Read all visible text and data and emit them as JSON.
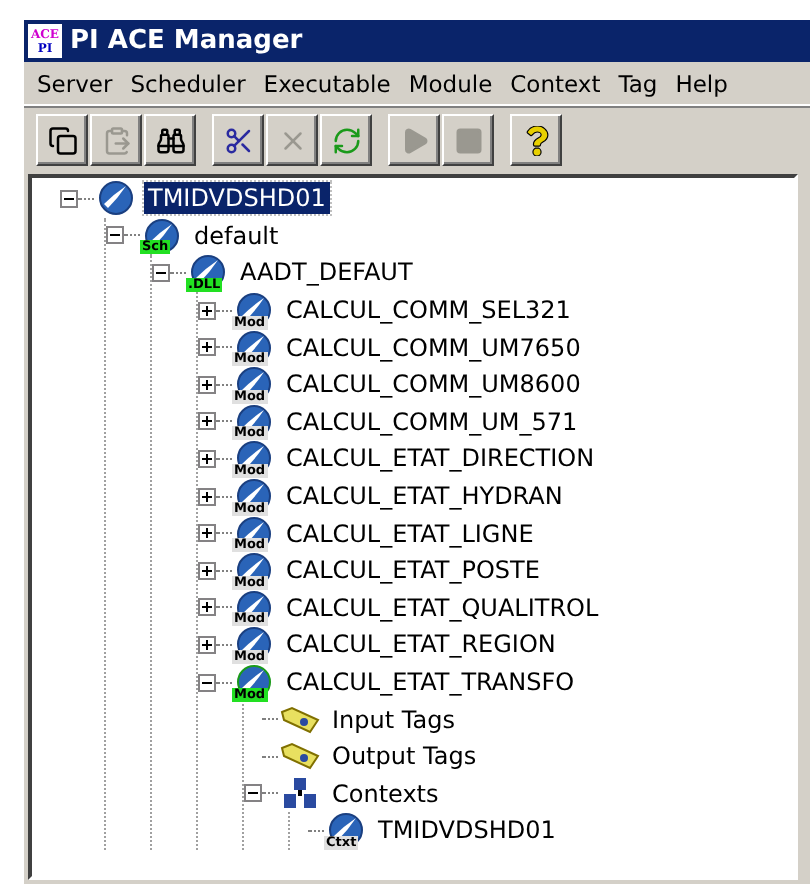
{
  "window": {
    "title": "PI ACE Manager",
    "app_icon": [
      "ACE",
      "PI"
    ]
  },
  "menu": [
    "Server",
    "Scheduler",
    "Executable",
    "Module",
    "Context",
    "Tag",
    "Help"
  ],
  "toolbar": [
    [
      {
        "kind": "copy",
        "disabled": false
      },
      {
        "kind": "paste",
        "disabled": true
      },
      {
        "kind": "find",
        "disabled": false
      }
    ],
    [
      {
        "kind": "cut",
        "disabled": false
      },
      {
        "kind": "delete",
        "disabled": true
      },
      {
        "kind": "refresh",
        "disabled": false
      }
    ],
    [
      {
        "kind": "play",
        "disabled": true
      },
      {
        "kind": "stop",
        "disabled": true
      }
    ],
    [
      {
        "kind": "help",
        "disabled": false
      }
    ]
  ],
  "tree": [
    {
      "label": "TMIDVDSHD01",
      "kind": "server",
      "selected": true,
      "expanded": true,
      "children": [
        {
          "label": "default",
          "kind": "scheduler",
          "badge": "Sch",
          "selected": false,
          "expanded": true,
          "children": [
            {
              "label": "AADT_DEFAUT",
              "kind": "dll",
              "badge": ".DLL",
              "selected": false,
              "expanded": true,
              "children": [
                {
                  "label": "CALCUL_COMM_SEL321",
                  "kind": "module",
                  "badge": "Mod",
                  "selected": false,
                  "expanded": false
                },
                {
                  "label": "CALCUL_COMM_UM7650",
                  "kind": "module",
                  "badge": "Mod",
                  "selected": false,
                  "expanded": false
                },
                {
                  "label": "CALCUL_COMM_UM8600",
                  "kind": "module",
                  "badge": "Mod",
                  "selected": false,
                  "expanded": false
                },
                {
                  "label": "CALCUL_COMM_UM_571",
                  "kind": "module",
                  "badge": "Mod",
                  "selected": false,
                  "expanded": false
                },
                {
                  "label": "CALCUL_ETAT_DIRECTION",
                  "kind": "module",
                  "badge": "Mod",
                  "selected": false,
                  "expanded": false
                },
                {
                  "label": "CALCUL_ETAT_HYDRAN",
                  "kind": "module",
                  "badge": "Mod",
                  "selected": false,
                  "expanded": false
                },
                {
                  "label": "CALCUL_ETAT_LIGNE",
                  "kind": "module",
                  "badge": "Mod",
                  "selected": false,
                  "expanded": false
                },
                {
                  "label": "CALCUL_ETAT_POSTE",
                  "kind": "module",
                  "badge": "Mod",
                  "selected": false,
                  "expanded": false
                },
                {
                  "label": "CALCUL_ETAT_QUALITROL",
                  "kind": "module",
                  "badge": "Mod",
                  "selected": false,
                  "expanded": false
                },
                {
                  "label": "CALCUL_ETAT_REGION",
                  "kind": "module",
                  "badge": "Mod",
                  "selected": false,
                  "expanded": false
                },
                {
                  "label": "CALCUL_ETAT_TRANSFO",
                  "kind": "active_module",
                  "badge": "Mod",
                  "selected": false,
                  "expanded": true,
                  "children": [
                    {
                      "label": "Input Tags",
                      "kind": "tags",
                      "selected": false
                    },
                    {
                      "label": "Output Tags",
                      "kind": "tags",
                      "selected": false
                    },
                    {
                      "label": "Contexts",
                      "kind": "contexts",
                      "selected": false,
                      "expanded": true,
                      "children": [
                        {
                          "label": "TMIDVDSHD01",
                          "kind": "context",
                          "badge": "Ctxt",
                          "selected": false
                        }
                      ]
                    }
                  ]
                }
              ]
            }
          ]
        }
      ]
    }
  ]
}
